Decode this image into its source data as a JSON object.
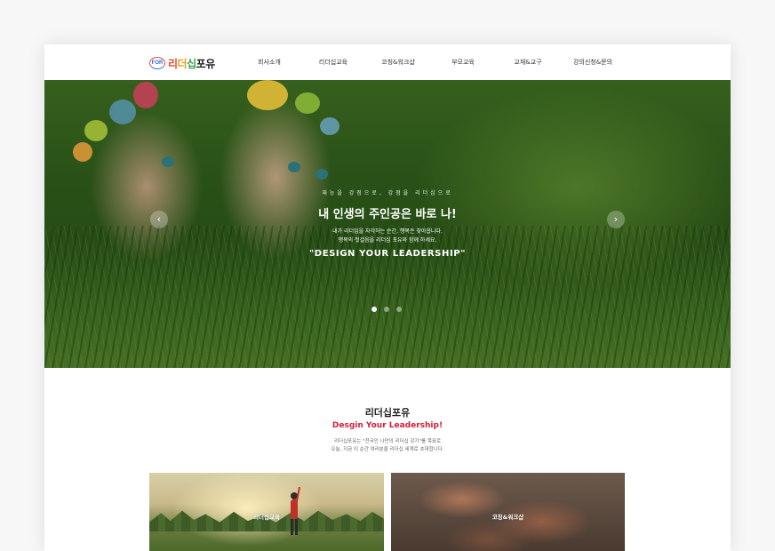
{
  "header": {
    "logo_mark": "FOR",
    "logo_chars": [
      "리",
      "더",
      "십",
      "포",
      "유"
    ],
    "nav": [
      "회사소개",
      "리더십교육",
      "코칭&워크샵",
      "부모교육",
      "교재&교구",
      "강의신청&문의"
    ]
  },
  "hero": {
    "kicker": "재능을 강점으로, 강점을 리더십으로",
    "title": "내 인생의 주인공은 바로 나!",
    "desc_line1": "내가 리더임을 자각하는 순간, 행복은 찾아옵니다.",
    "desc_line2": "행복의 첫걸음을 리더십 포유와 함께 하세요.",
    "slogan": "\"DESIGN YOUR LEADERSHIP\"",
    "prev_symbol": "‹",
    "next_symbol": "›",
    "slide_count": 3,
    "active_slide": 1
  },
  "intro": {
    "title": "리더십포유",
    "subtitle": "Desgin Your Leadership!",
    "desc_line1": "리더십포유는 \"천국인 나만의 리더십 갖기\"를 목표로",
    "desc_line2": "오늘, 지금 이 순간 여러분을 리더십 세계로 초대합니다."
  },
  "cards": [
    {
      "label": "리더십교육"
    },
    {
      "label": "코칭&워크샵"
    }
  ],
  "colors": {
    "accent_red": "#d41f3b",
    "logo_red": "#e64a3b",
    "logo_orange": "#f29a1b",
    "logo_green": "#3ba15a",
    "logo_blue": "#2f6fd0"
  }
}
